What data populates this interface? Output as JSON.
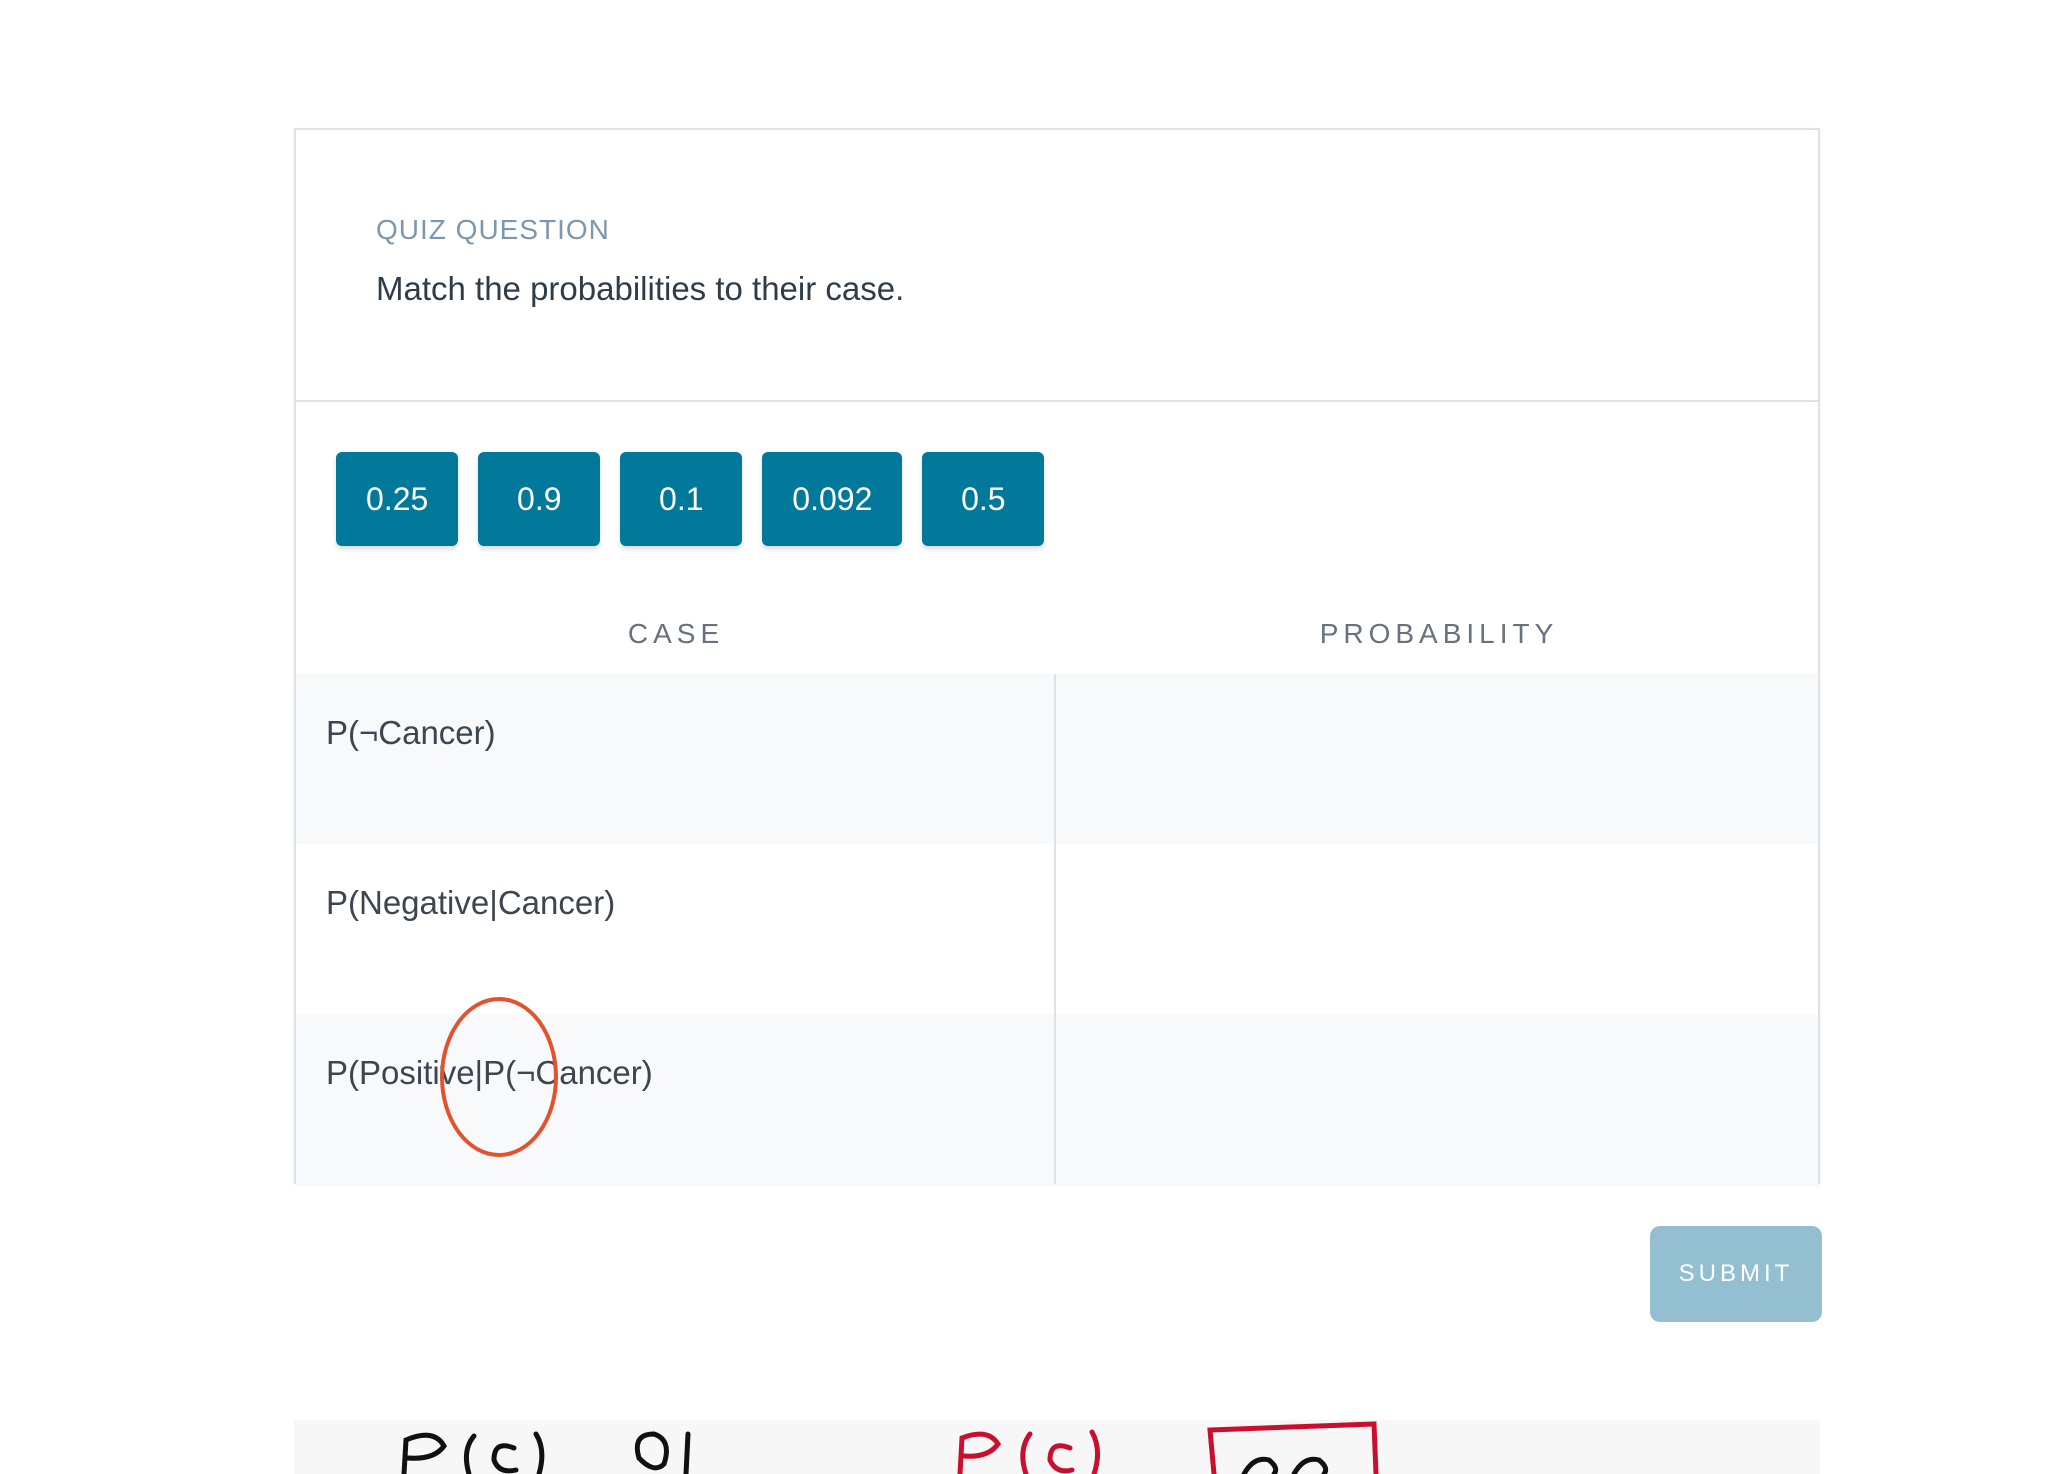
{
  "quiz": {
    "label": "QUIZ QUESTION",
    "prompt": "Match the probabilities to their case."
  },
  "options": [
    "0.25",
    "0.9",
    "0.1",
    "0.092",
    "0.5"
  ],
  "table": {
    "case_header": "CASE",
    "probability_header": "PROBABILITY",
    "rows": [
      {
        "case": "P(¬Cancer)",
        "probability": ""
      },
      {
        "case": "P(Negative|Cancer)",
        "probability": ""
      },
      {
        "case": "P(Positive|P(¬Cancer)",
        "probability": ""
      }
    ]
  },
  "submit_label": "SUBMIT",
  "colors": {
    "chip": "#02789a",
    "submit_disabled": "#93bfd0",
    "annotation": "#e2522f",
    "sketch_black": "#111111",
    "sketch_red": "#c8102e"
  }
}
